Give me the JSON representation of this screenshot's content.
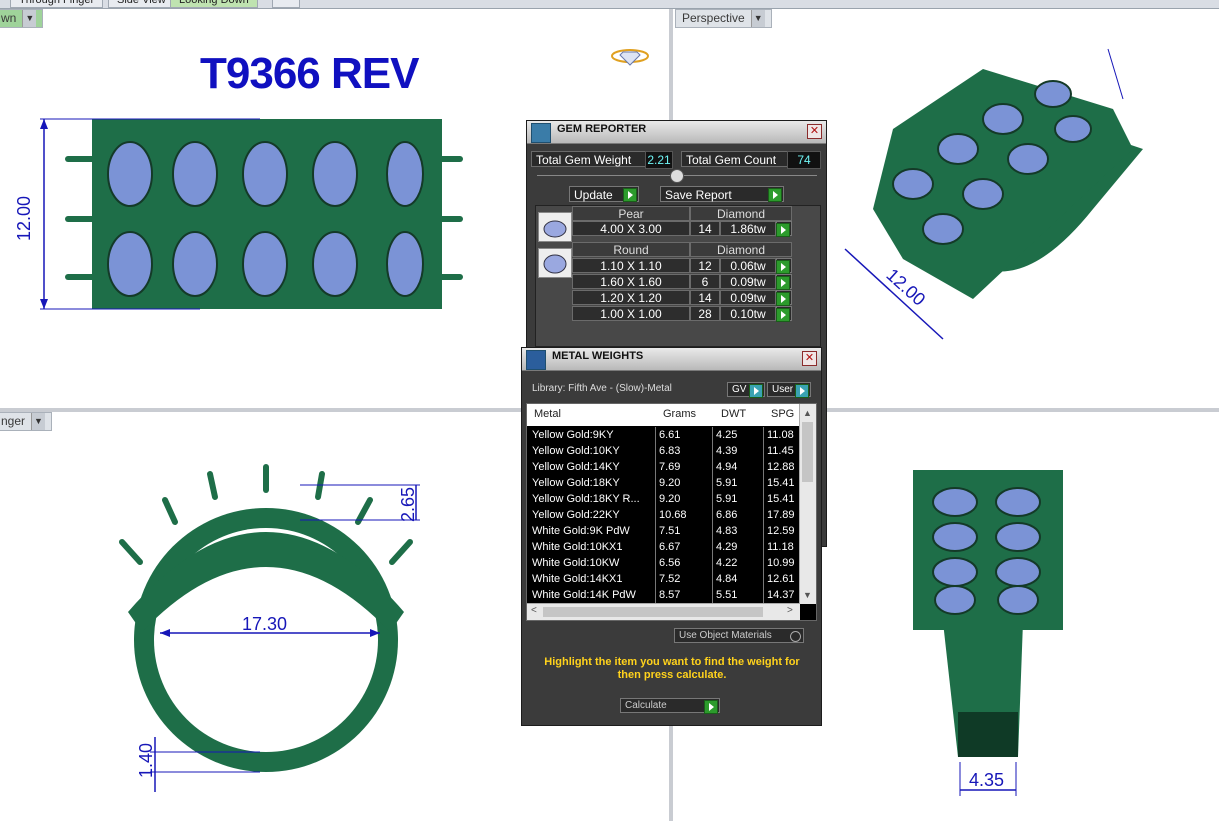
{
  "tabs": [
    "Through Finger",
    "Side View",
    "Looking Down",
    ""
  ],
  "viewports": {
    "top_left": {
      "label": "wn",
      "title": "T9366 REV",
      "dim_height": "12.00"
    },
    "top_right": {
      "label": "Perspective",
      "dim_width": "12.00"
    },
    "bottom_left": {
      "label": "nger",
      "dim_inner": "17.30",
      "dim_top": "2.65",
      "dim_shank": "1.40"
    },
    "bottom_right": {
      "dim_width": "4.35"
    }
  },
  "gem_reporter": {
    "title": "GEM REPORTER",
    "total_weight_label": "Total Gem Weight",
    "total_weight_value": "2.21",
    "total_count_label": "Total Gem Count",
    "total_count_value": "74",
    "update_label": "Update",
    "save_label": "Save Report",
    "groups": [
      {
        "shape": "Pear",
        "material": "Diamond",
        "rows": [
          {
            "size": "4.00 X 3.00",
            "count": "14",
            "weight": "1.86tw"
          }
        ]
      },
      {
        "shape": "Round",
        "material": "Diamond",
        "rows": [
          {
            "size": "1.10 X 1.10",
            "count": "12",
            "weight": "0.06tw"
          },
          {
            "size": "1.60 X 1.60",
            "count": "6",
            "weight": "0.09tw"
          },
          {
            "size": "1.20 X 1.20",
            "count": "14",
            "weight": "0.09tw"
          },
          {
            "size": "1.00 X 1.00",
            "count": "28",
            "weight": "0.10tw"
          }
        ]
      }
    ]
  },
  "metal_weights": {
    "title": "METAL WEIGHTS",
    "library": "Library: Fifth Ave - (Slow)-Metal",
    "gv_label": "GV",
    "user_label": "User",
    "columns": [
      "Metal",
      "Grams",
      "DWT",
      "SPG"
    ],
    "rows": [
      [
        "Yellow Gold:9KY",
        "6.61",
        "4.25",
        "11.08"
      ],
      [
        "Yellow Gold:10KY",
        "6.83",
        "4.39",
        "11.45"
      ],
      [
        "Yellow Gold:14KY",
        "7.69",
        "4.94",
        "12.88"
      ],
      [
        "Yellow Gold:18KY",
        "9.20",
        "5.91",
        "15.41"
      ],
      [
        "Yellow Gold:18KY R...",
        "9.20",
        "5.91",
        "15.41"
      ],
      [
        "Yellow Gold:22KY",
        "10.68",
        "6.86",
        "17.89"
      ],
      [
        "White Gold:9K PdW",
        "7.51",
        "4.83",
        "12.59"
      ],
      [
        "White Gold:10KX1",
        "6.67",
        "4.29",
        "11.18"
      ],
      [
        "White Gold:10KW",
        "6.56",
        "4.22",
        "10.99"
      ],
      [
        "White Gold:14KX1",
        "7.52",
        "4.84",
        "12.61"
      ],
      [
        "White Gold:14K PdW",
        "8.57",
        "5.51",
        "14.37"
      ]
    ],
    "use_object_label": "Use Object Materials",
    "hint": "Highlight the item you want to find the weight for then press calculate.",
    "calculate_label": "Calculate"
  },
  "colors": {
    "ring_green": "#1e6e48",
    "gem_blue": "#7b93d6",
    "dim_blue": "#1717b8",
    "panel_bg": "#3b3b3b"
  }
}
